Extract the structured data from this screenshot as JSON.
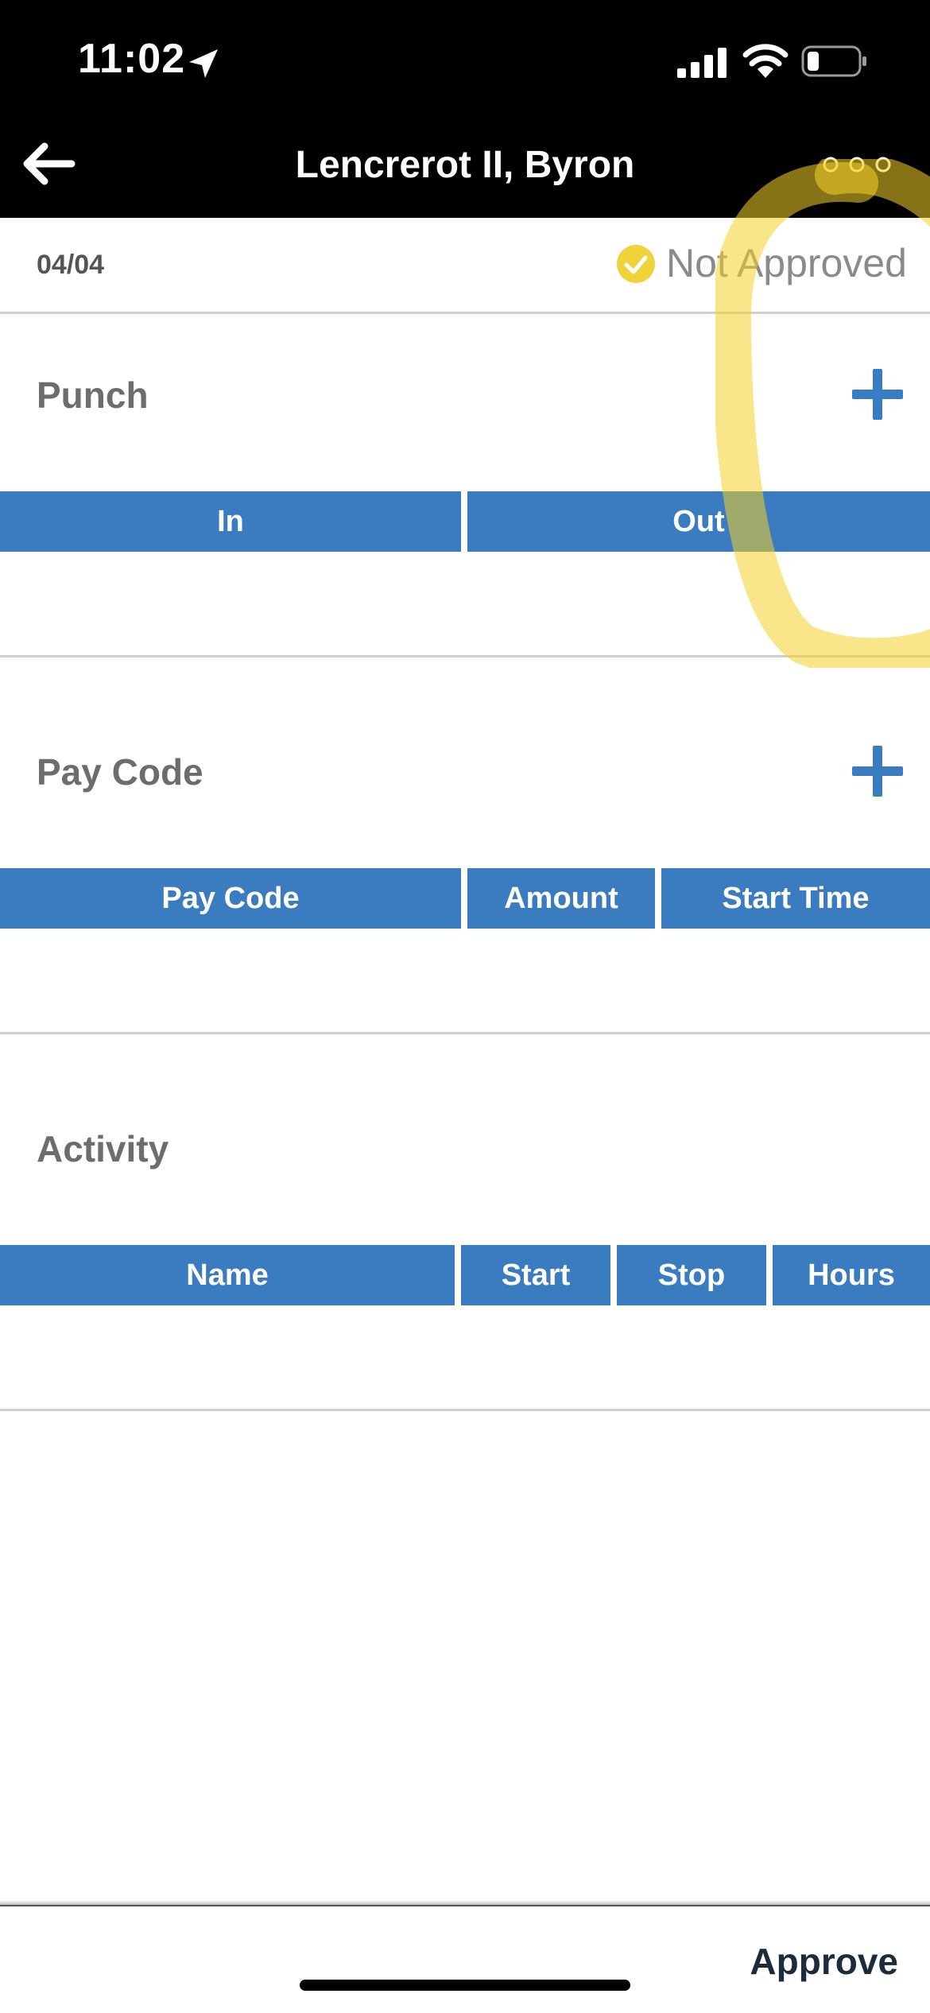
{
  "status_bar": {
    "time": "11:02"
  },
  "nav": {
    "title": "Lencrerot II, Byron"
  },
  "summary": {
    "date": "04/04",
    "status": "Not Approved"
  },
  "sections": {
    "punch": {
      "title": "Punch",
      "columns": [
        "In",
        "Out"
      ]
    },
    "pay_code": {
      "title": "Pay Code",
      "columns": [
        "Pay Code",
        "Amount",
        "Start Time"
      ]
    },
    "activity": {
      "title": "Activity",
      "columns": [
        "Name",
        "Start",
        "Stop",
        "Hours"
      ]
    }
  },
  "footer": {
    "approve_label": "Approve"
  },
  "colors": {
    "header_blue": "#3b7bbf",
    "status_yellow": "#f0d33a",
    "nav_bg": "#000000"
  }
}
